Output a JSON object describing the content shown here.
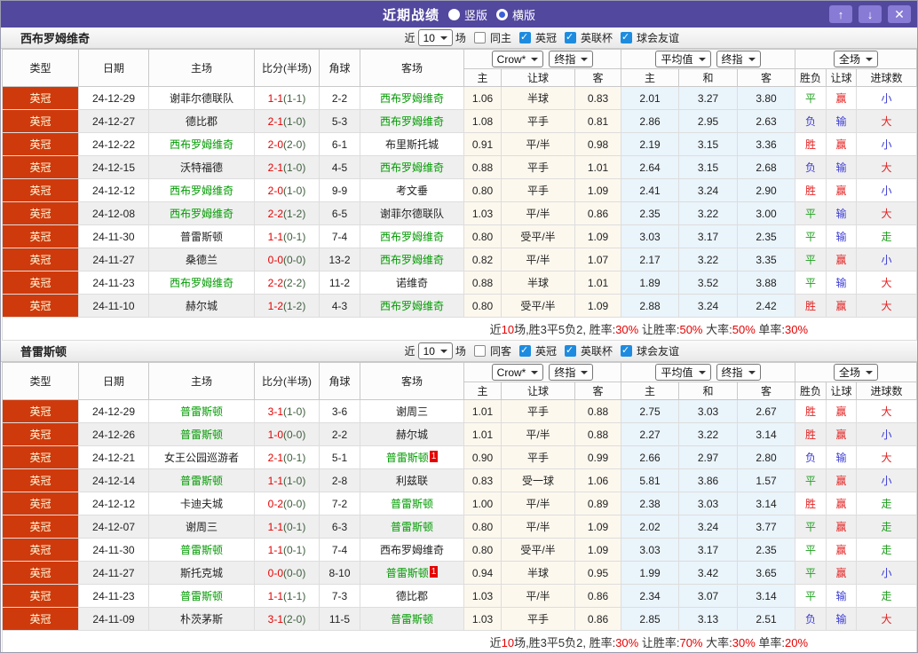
{
  "titlebar": {
    "title": "近期战绩",
    "vertical_label": "竖版",
    "horizontal_label": "横版",
    "vertical_selected": true,
    "up_icon": "↑",
    "down_icon": "↓",
    "close_icon": "✕"
  },
  "controls": {
    "near_label": "近",
    "count": "10",
    "games_label": "场",
    "leagues": [
      "英冠",
      "英联杯",
      "球会友谊"
    ],
    "leagues_checked": [
      true,
      true,
      true
    ]
  },
  "dropdowns": {
    "crown": "Crow*",
    "final": "终指",
    "avg": "平均值",
    "full": "全场"
  },
  "columns": {
    "type": "类型",
    "date": "日期",
    "home": "主场",
    "score": "比分(半场)",
    "corners": "角球",
    "away": "客场",
    "sub": [
      "主",
      "让球",
      "客",
      "主",
      "和",
      "客",
      "胜负",
      "让球",
      "进球数"
    ]
  },
  "colors": {
    "titlebar_purple": "#52489e",
    "button_purple": "#877bd6",
    "league_red": "#cf3a0c",
    "checkbox_blue": "#1d8ce0",
    "win_red": "#e32222",
    "draw_green": "#1f9e1f",
    "lose_blue": "#3b3bd6",
    "focus_team_green": "#009b00",
    "score_red": "#e60000",
    "crown_group_bg": "#fdf8ee",
    "avg_group_bg": "#eaf4fb"
  },
  "tables": [
    {
      "team": "西布罗姆维奇",
      "same_label": "同主",
      "same_checked": false,
      "rows": [
        {
          "lg": "英冠",
          "d": "24-12-29",
          "h": "谢菲尔德联队",
          "hg": false,
          "ft": "1-1",
          "ht": "(1-1)",
          "c": "2-2",
          "a": "西布罗姆维奇",
          "ag": true,
          "ab": "",
          "o": [
            "1.06",
            "半球",
            "0.83",
            "2.01",
            "3.27",
            "3.80"
          ],
          "r": [
            [
              "平",
              "g"
            ],
            [
              "赢",
              "r"
            ],
            [
              "小",
              "b"
            ]
          ]
        },
        {
          "lg": "英冠",
          "d": "24-12-27",
          "h": "德比郡",
          "hg": false,
          "ft": "2-1",
          "ht": "(1-0)",
          "c": "5-3",
          "a": "西布罗姆维奇",
          "ag": true,
          "ab": "",
          "o": [
            "1.08",
            "平手",
            "0.81",
            "2.86",
            "2.95",
            "2.63"
          ],
          "r": [
            [
              "负",
              "b"
            ],
            [
              "输",
              "b"
            ],
            [
              "大",
              "r"
            ]
          ]
        },
        {
          "lg": "英冠",
          "d": "24-12-22",
          "h": "西布罗姆维奇",
          "hg": true,
          "ft": "2-0",
          "ht": "(2-0)",
          "c": "6-1",
          "a": "布里斯托城",
          "ag": false,
          "ab": "",
          "o": [
            "0.91",
            "平/半",
            "0.98",
            "2.19",
            "3.15",
            "3.36"
          ],
          "r": [
            [
              "胜",
              "r"
            ],
            [
              "赢",
              "r"
            ],
            [
              "小",
              "b"
            ]
          ]
        },
        {
          "lg": "英冠",
          "d": "24-12-15",
          "h": "沃特福德",
          "hg": false,
          "ft": "2-1",
          "ht": "(1-0)",
          "c": "4-5",
          "a": "西布罗姆维奇",
          "ag": true,
          "ab": "",
          "o": [
            "0.88",
            "平手",
            "1.01",
            "2.64",
            "3.15",
            "2.68"
          ],
          "r": [
            [
              "负",
              "b"
            ],
            [
              "输",
              "b"
            ],
            [
              "大",
              "r"
            ]
          ]
        },
        {
          "lg": "英冠",
          "d": "24-12-12",
          "h": "西布罗姆维奇",
          "hg": true,
          "ft": "2-0",
          "ht": "(1-0)",
          "c": "9-9",
          "a": "考文垂",
          "ag": false,
          "ab": "",
          "o": [
            "0.80",
            "平手",
            "1.09",
            "2.41",
            "3.24",
            "2.90"
          ],
          "r": [
            [
              "胜",
              "r"
            ],
            [
              "赢",
              "r"
            ],
            [
              "小",
              "b"
            ]
          ]
        },
        {
          "lg": "英冠",
          "d": "24-12-08",
          "h": "西布罗姆维奇",
          "hg": true,
          "ft": "2-2",
          "ht": "(1-2)",
          "c": "6-5",
          "a": "谢菲尔德联队",
          "ag": false,
          "ab": "",
          "o": [
            "1.03",
            "平/半",
            "0.86",
            "2.35",
            "3.22",
            "3.00"
          ],
          "r": [
            [
              "平",
              "g"
            ],
            [
              "输",
              "b"
            ],
            [
              "大",
              "r"
            ]
          ]
        },
        {
          "lg": "英冠",
          "d": "24-11-30",
          "h": "普雷斯顿",
          "hg": false,
          "ft": "1-1",
          "ht": "(0-1)",
          "c": "7-4",
          "a": "西布罗姆维奇",
          "ag": true,
          "ab": "",
          "o": [
            "0.80",
            "受平/半",
            "1.09",
            "3.03",
            "3.17",
            "2.35"
          ],
          "r": [
            [
              "平",
              "g"
            ],
            [
              "输",
              "b"
            ],
            [
              "走",
              "g"
            ]
          ]
        },
        {
          "lg": "英冠",
          "d": "24-11-27",
          "h": "桑德兰",
          "hg": false,
          "ft": "0-0",
          "ht": "(0-0)",
          "c": "13-2",
          "a": "西布罗姆维奇",
          "ag": true,
          "ab": "",
          "o": [
            "0.82",
            "平/半",
            "1.07",
            "2.17",
            "3.22",
            "3.35"
          ],
          "r": [
            [
              "平",
              "g"
            ],
            [
              "赢",
              "r"
            ],
            [
              "小",
              "b"
            ]
          ]
        },
        {
          "lg": "英冠",
          "d": "24-11-23",
          "h": "西布罗姆维奇",
          "hg": true,
          "ft": "2-2",
          "ht": "(2-2)",
          "c": "11-2",
          "a": "诺维奇",
          "ag": false,
          "ab": "",
          "o": [
            "0.88",
            "半球",
            "1.01",
            "1.89",
            "3.52",
            "3.88"
          ],
          "r": [
            [
              "平",
              "g"
            ],
            [
              "输",
              "b"
            ],
            [
              "大",
              "r"
            ]
          ]
        },
        {
          "lg": "英冠",
          "d": "24-11-10",
          "h": "赫尔城",
          "hg": false,
          "ft": "1-2",
          "ht": "(1-2)",
          "c": "4-3",
          "a": "西布罗姆维奇",
          "ag": true,
          "ab": "",
          "o": [
            "0.80",
            "受平/半",
            "1.09",
            "2.88",
            "3.24",
            "2.42"
          ],
          "r": [
            [
              "胜",
              "r"
            ],
            [
              "赢",
              "r"
            ],
            [
              "大",
              "r"
            ]
          ]
        }
      ],
      "summary": [
        [
          "近",
          false
        ],
        [
          "10",
          true
        ],
        [
          "场,胜3平5负2, 胜率:",
          false
        ],
        [
          "30%",
          true
        ],
        [
          " 让胜率:",
          false
        ],
        [
          "50%",
          true
        ],
        [
          " 大率:",
          false
        ],
        [
          "50%",
          true
        ],
        [
          " 单率:",
          false
        ],
        [
          "30%",
          true
        ]
      ]
    },
    {
      "team": "普雷斯顿",
      "same_label": "同客",
      "same_checked": false,
      "rows": [
        {
          "lg": "英冠",
          "d": "24-12-29",
          "h": "普雷斯顿",
          "hg": true,
          "ft": "3-1",
          "ht": "(1-0)",
          "c": "3-6",
          "a": "谢周三",
          "ag": false,
          "ab": "",
          "o": [
            "1.01",
            "平手",
            "0.88",
            "2.75",
            "3.03",
            "2.67"
          ],
          "r": [
            [
              "胜",
              "r"
            ],
            [
              "赢",
              "r"
            ],
            [
              "大",
              "r"
            ]
          ]
        },
        {
          "lg": "英冠",
          "d": "24-12-26",
          "h": "普雷斯顿",
          "hg": true,
          "ft": "1-0",
          "ht": "(0-0)",
          "c": "2-2",
          "a": "赫尔城",
          "ag": false,
          "ab": "",
          "o": [
            "1.01",
            "平/半",
            "0.88",
            "2.27",
            "3.22",
            "3.14"
          ],
          "r": [
            [
              "胜",
              "r"
            ],
            [
              "赢",
              "r"
            ],
            [
              "小",
              "b"
            ]
          ]
        },
        {
          "lg": "英冠",
          "d": "24-12-21",
          "h": "女王公园巡游者",
          "hg": false,
          "ft": "2-1",
          "ht": "(0-1)",
          "c": "5-1",
          "a": "普雷斯顿",
          "ag": true,
          "ab": "1",
          "o": [
            "0.90",
            "平手",
            "0.99",
            "2.66",
            "2.97",
            "2.80"
          ],
          "r": [
            [
              "负",
              "b"
            ],
            [
              "输",
              "b"
            ],
            [
              "大",
              "r"
            ]
          ]
        },
        {
          "lg": "英冠",
          "d": "24-12-14",
          "h": "普雷斯顿",
          "hg": true,
          "ft": "1-1",
          "ht": "(1-0)",
          "c": "2-8",
          "a": "利兹联",
          "ag": false,
          "ab": "",
          "o": [
            "0.83",
            "受一球",
            "1.06",
            "5.81",
            "3.86",
            "1.57"
          ],
          "r": [
            [
              "平",
              "g"
            ],
            [
              "赢",
              "r"
            ],
            [
              "小",
              "b"
            ]
          ]
        },
        {
          "lg": "英冠",
          "d": "24-12-12",
          "h": "卡迪夫城",
          "hg": false,
          "ft": "0-2",
          "ht": "(0-0)",
          "c": "7-2",
          "a": "普雷斯顿",
          "ag": true,
          "ab": "",
          "o": [
            "1.00",
            "平/半",
            "0.89",
            "2.38",
            "3.03",
            "3.14"
          ],
          "r": [
            [
              "胜",
              "r"
            ],
            [
              "赢",
              "r"
            ],
            [
              "走",
              "g"
            ]
          ]
        },
        {
          "lg": "英冠",
          "d": "24-12-07",
          "h": "谢周三",
          "hg": false,
          "ft": "1-1",
          "ht": "(0-1)",
          "c": "6-3",
          "a": "普雷斯顿",
          "ag": true,
          "ab": "",
          "o": [
            "0.80",
            "平/半",
            "1.09",
            "2.02",
            "3.24",
            "3.77"
          ],
          "r": [
            [
              "平",
              "g"
            ],
            [
              "赢",
              "r"
            ],
            [
              "走",
              "g"
            ]
          ]
        },
        {
          "lg": "英冠",
          "d": "24-11-30",
          "h": "普雷斯顿",
          "hg": true,
          "ft": "1-1",
          "ht": "(0-1)",
          "c": "7-4",
          "a": "西布罗姆维奇",
          "ag": false,
          "ab": "",
          "o": [
            "0.80",
            "受平/半",
            "1.09",
            "3.03",
            "3.17",
            "2.35"
          ],
          "r": [
            [
              "平",
              "g"
            ],
            [
              "赢",
              "r"
            ],
            [
              "走",
              "g"
            ]
          ]
        },
        {
          "lg": "英冠",
          "d": "24-11-27",
          "h": "斯托克城",
          "hg": false,
          "ft": "0-0",
          "ht": "(0-0)",
          "c": "8-10",
          "a": "普雷斯顿",
          "ag": true,
          "ab": "1",
          "o": [
            "0.94",
            "半球",
            "0.95",
            "1.99",
            "3.42",
            "3.65"
          ],
          "r": [
            [
              "平",
              "g"
            ],
            [
              "赢",
              "r"
            ],
            [
              "小",
              "b"
            ]
          ]
        },
        {
          "lg": "英冠",
          "d": "24-11-23",
          "h": "普雷斯顿",
          "hg": true,
          "ft": "1-1",
          "ht": "(1-1)",
          "c": "7-3",
          "a": "德比郡",
          "ag": false,
          "ab": "",
          "o": [
            "1.03",
            "平/半",
            "0.86",
            "2.34",
            "3.07",
            "3.14"
          ],
          "r": [
            [
              "平",
              "g"
            ],
            [
              "输",
              "b"
            ],
            [
              "走",
              "g"
            ]
          ]
        },
        {
          "lg": "英冠",
          "d": "24-11-09",
          "h": "朴茨茅斯",
          "hg": false,
          "ft": "3-1",
          "ht": "(2-0)",
          "c": "11-5",
          "a": "普雷斯顿",
          "ag": true,
          "ab": "",
          "o": [
            "1.03",
            "平手",
            "0.86",
            "2.85",
            "3.13",
            "2.51"
          ],
          "r": [
            [
              "负",
              "b"
            ],
            [
              "输",
              "b"
            ],
            [
              "大",
              "r"
            ]
          ]
        }
      ],
      "summary": [
        [
          "近",
          false
        ],
        [
          "10",
          true
        ],
        [
          "场,胜3平5负2, 胜率:",
          false
        ],
        [
          "30%",
          true
        ],
        [
          " 让胜率:",
          false
        ],
        [
          "70%",
          true
        ],
        [
          " 大率:",
          false
        ],
        [
          "30%",
          true
        ],
        [
          " 单率:",
          false
        ],
        [
          "20%",
          true
        ]
      ]
    }
  ]
}
